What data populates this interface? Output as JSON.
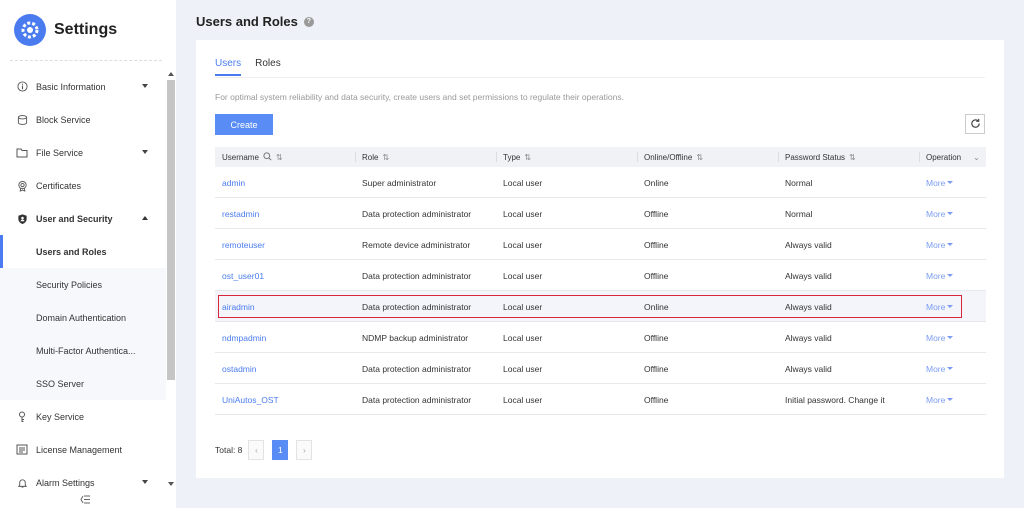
{
  "sidebar": {
    "title": "Settings",
    "items": [
      {
        "label": "Basic Information",
        "icon": "info-icon"
      },
      {
        "label": "Block Service",
        "icon": "database-icon"
      },
      {
        "label": "File Service",
        "icon": "folder-icon"
      },
      {
        "label": "Certificates",
        "icon": "certificate-icon"
      },
      {
        "label": "User and Security",
        "icon": "shield-icon"
      },
      {
        "label": "Key Service",
        "icon": "key-icon"
      },
      {
        "label": "License Management",
        "icon": "license-icon"
      },
      {
        "label": "Alarm Settings",
        "icon": "bell-icon"
      }
    ],
    "sub_items": [
      {
        "label": "Users and Roles"
      },
      {
        "label": "Security Policies"
      },
      {
        "label": "Domain Authentication"
      },
      {
        "label": "Multi-Factor Authentica..."
      },
      {
        "label": "SSO Server"
      }
    ]
  },
  "page": {
    "title": "Users and Roles",
    "tabs": [
      {
        "label": "Users"
      },
      {
        "label": "Roles"
      }
    ],
    "description": "For optimal system reliability and data security, create users and set permissions to regulate their operations.",
    "create_label": "Create"
  },
  "table": {
    "headers": [
      "Username",
      "Role",
      "Type",
      "Online/Offline",
      "Password Status",
      "Operation"
    ],
    "rows": [
      {
        "username": "admin",
        "role": "Super administrator",
        "type": "Local user",
        "status": "Online",
        "password": "Normal",
        "op": "More"
      },
      {
        "username": "restadmin",
        "role": "Data protection administrator",
        "type": "Local user",
        "status": "Offline",
        "password": "Normal",
        "op": "More"
      },
      {
        "username": "remoteuser",
        "role": "Remote device administrator",
        "type": "Local user",
        "status": "Offline",
        "password": "Always valid",
        "op": "More"
      },
      {
        "username": "ost_user01",
        "role": "Data protection administrator",
        "type": "Local user",
        "status": "Offline",
        "password": "Always valid",
        "op": "More"
      },
      {
        "username": "airadmin",
        "role": "Data protection administrator",
        "type": "Local user",
        "status": "Online",
        "password": "Always valid",
        "op": "More"
      },
      {
        "username": "ndmpadmin",
        "role": "NDMP backup administrator",
        "type": "Local user",
        "status": "Offline",
        "password": "Always valid",
        "op": "More"
      },
      {
        "username": "ostadmin",
        "role": "Data protection administrator",
        "type": "Local user",
        "status": "Offline",
        "password": "Always valid",
        "op": "More"
      },
      {
        "username": "UniAutos_OST",
        "role": "Data protection administrator",
        "type": "Local user",
        "status": "Offline",
        "password": "Initial password. Change it",
        "op": "More"
      }
    ]
  },
  "pager": {
    "total": "Total: 8",
    "current": "1",
    "prev": "‹",
    "next": "›"
  },
  "colors": {
    "accent": "#4a7cf0",
    "highlight_border": "#d9253b"
  }
}
